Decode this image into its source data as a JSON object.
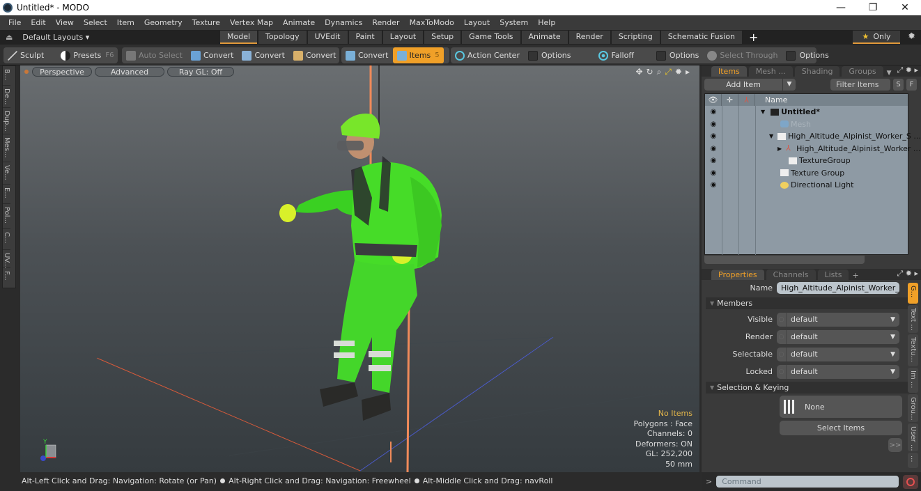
{
  "window": {
    "title": "Untitled* - MODO",
    "minimize": "—",
    "maximize": "❐",
    "close": "✕"
  },
  "menu": [
    "File",
    "Edit",
    "View",
    "Select",
    "Item",
    "Geometry",
    "Texture",
    "Vertex Map",
    "Animate",
    "Dynamics",
    "Render",
    "MaxToModo",
    "Layout",
    "System",
    "Help"
  ],
  "layouts": {
    "dropdown": "Default Layouts ▾",
    "tabs": [
      "Model",
      "Topology",
      "UVEdit",
      "Paint",
      "Layout",
      "Setup",
      "Game Tools",
      "Animate",
      "Render",
      "Scripting",
      "Schematic Fusion"
    ],
    "active": "Model",
    "add": "+",
    "only": "Only"
  },
  "toolbar": {
    "sculpt": "Sculpt",
    "presets": "Presets",
    "presets_key": "F6",
    "auto_select": "Auto Select",
    "convert1": "Convert",
    "convert2": "Convert",
    "convert3": "Convert",
    "convert4": "Convert",
    "items": "Items",
    "items_key": "5",
    "action_center": "Action Center",
    "options1": "Options",
    "falloff": "Falloff",
    "options2": "Options",
    "select_through": "Select Through",
    "options3": "Options"
  },
  "left_tabs": [
    "B...",
    "De...",
    "Dup...",
    "Mes...",
    "Ve...",
    "E...",
    "Pol...",
    "C...",
    "UV...",
    "F..."
  ],
  "viewport": {
    "view": "Perspective",
    "shading": "Advanced",
    "raygl": "Ray GL: Off",
    "hud": {
      "selection": "No Items",
      "polygons": "Polygons : Face",
      "channels": "Channels: 0",
      "deformers": "Deformers: ON",
      "gl": "GL: 252,200",
      "lens": "50 mm"
    },
    "axis_label": "Y"
  },
  "status": {
    "hint1": "Alt-Left Click and Drag: Navigation: Rotate (or Pan)",
    "hint2": "Alt-Right Click and Drag: Navigation: Freewheel",
    "hint3": "Alt-Middle Click and Drag: navRoll"
  },
  "items_panel": {
    "tabs": [
      "Items",
      "Mesh ...",
      "Shading",
      "Groups"
    ],
    "active": "Items",
    "add_item": "Add Item",
    "filter": "Filter Items",
    "s_btn": "S",
    "f_btn": "F",
    "column_name": "Name",
    "rows": [
      {
        "name": "Untitled*",
        "type": "scene"
      },
      {
        "name": "Mesh",
        "type": "mesh"
      },
      {
        "name": "High_Altitude_Alpinist_Worker_S ...",
        "type": "group"
      },
      {
        "name": "High_Altitude_Alpinist_Worker ...",
        "type": "locator"
      },
      {
        "name": "TextureGroup",
        "type": "group"
      },
      {
        "name": "Texture Group",
        "type": "group"
      },
      {
        "name": "Directional Light",
        "type": "light"
      }
    ]
  },
  "properties_panel": {
    "tabs": [
      "Properties",
      "Channels",
      "Lists"
    ],
    "active": "Properties",
    "add": "+",
    "name_label": "Name",
    "name_value": "High_Altitude_Alpinist_Worker_Susp",
    "members_section": "Members",
    "fields": [
      {
        "label": "Visible",
        "value": "default"
      },
      {
        "label": "Render",
        "value": "default"
      },
      {
        "label": "Selectable",
        "value": "default"
      },
      {
        "label": "Locked",
        "value": "default"
      }
    ],
    "keying_section": "Selection & Keying",
    "none_btn": "None",
    "select_items_btn": "Select Items",
    "more_btn": ">>",
    "side_tabs": [
      "G...",
      "Text ...",
      "Textu...",
      "Im ...",
      "Grou...",
      "User ...",
      "..."
    ]
  },
  "command": {
    "prompt": ">",
    "placeholder": "Command"
  },
  "colors": {
    "accent": "#f0a028",
    "x_axis": "#d65a3a",
    "z_axis": "#4a5ac8",
    "suit": "#52e034"
  }
}
